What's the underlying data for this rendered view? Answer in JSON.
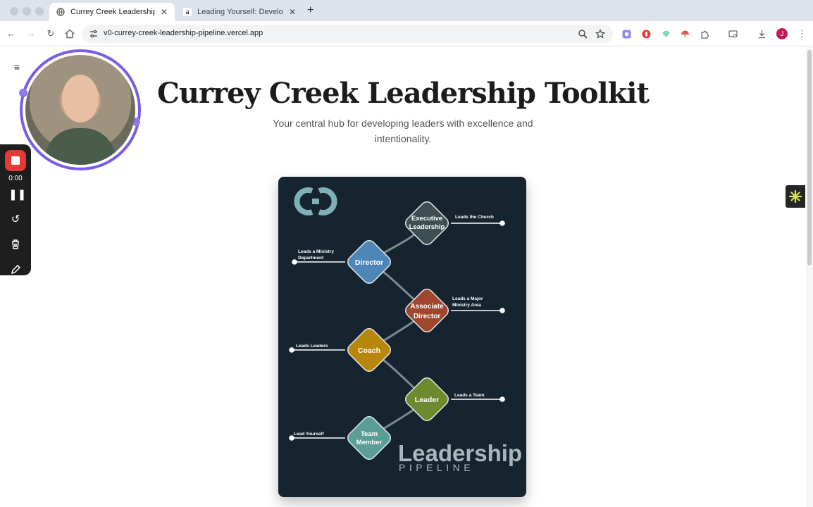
{
  "browser": {
    "tabs": [
      {
        "title": "Currey Creek Leadership Too",
        "active": true
      },
      {
        "title": "Leading Yourself: Developing",
        "active": false
      }
    ],
    "url": "v0-currey-creek-leadership-pipeline.vercel.app",
    "profile_initial": "J"
  },
  "page": {
    "title": "Currey Creek Leadership Toolkit",
    "subtitle": "Your central hub for developing leaders with excellence and intentionality."
  },
  "recorder": {
    "time": "0:00"
  },
  "pipeline": {
    "logo": "CC",
    "brand_main": "Leadership",
    "brand_sub": "PIPELINE",
    "nodes": [
      {
        "line1": "Executive",
        "line2": "Leadership",
        "color": "#3e4f54",
        "desc1": "Leads the Church",
        "desc2": ""
      },
      {
        "line1": "Director",
        "line2": "",
        "color": "#4e86b8",
        "desc1": "Leads a Ministry",
        "desc2": "Department"
      },
      {
        "line1": "Associate",
        "line2": "Director",
        "color": "#a0462c",
        "desc1": "Leads a Major",
        "desc2": "Ministry Area"
      },
      {
        "line1": "Coach",
        "line2": "",
        "color": "#b8860b",
        "desc1": "Leads Leaders",
        "desc2": ""
      },
      {
        "line1": "Leader",
        "line2": "",
        "color": "#6f8a2e",
        "desc1": "Leads a Team",
        "desc2": ""
      },
      {
        "line1": "Team",
        "line2": "Member",
        "color": "#5a9e95",
        "desc1": "Lead Yourself",
        "desc2": ""
      }
    ]
  }
}
